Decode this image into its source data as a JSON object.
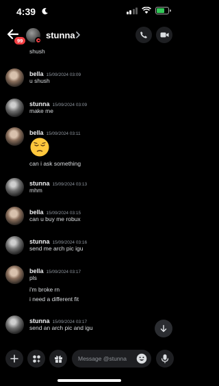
{
  "status_bar": {
    "time": "4:39",
    "battery_level_percent": 70
  },
  "header": {
    "unread_badge": "99",
    "user_name": "stunna"
  },
  "composer": {
    "placeholder": "Message @stunna"
  },
  "messages": [
    {
      "author": "",
      "timestamp": "",
      "lines": [
        "shush"
      ]
    },
    {
      "author": "bella",
      "timestamp": "15/09/2024 03:09",
      "lines": [
        "u shush"
      ]
    },
    {
      "author": "stunna",
      "timestamp": "15/09/2024 03:09",
      "lines": [
        "make me"
      ]
    },
    {
      "author": "bella",
      "timestamp": "15/09/2024 03:11",
      "emoji": "pensive-face",
      "lines": [
        "can i ask something"
      ]
    },
    {
      "author": "stunna",
      "timestamp": "15/09/2024 03:13",
      "lines": [
        "mhm"
      ]
    },
    {
      "author": "bella",
      "timestamp": "15/09/2024 03:15",
      "lines": [
        "can u buy me robux"
      ]
    },
    {
      "author": "stunna",
      "timestamp": "15/09/2024 03:16",
      "lines": [
        "send me arch pic igu"
      ]
    },
    {
      "author": "bella",
      "timestamp": "15/09/2024 03:17",
      "lines": [
        "pls",
        "i'm broke rn",
        "i need a different fit"
      ]
    },
    {
      "author": "stunna",
      "timestamp": "15/09/2024 03:17",
      "lines": [
        "send an arch pic and igu"
      ]
    }
  ],
  "colors": {
    "background": "#000000",
    "dnd_red": "#f23f43",
    "battery_green": "#34c759",
    "surface": "#1e1f22"
  }
}
